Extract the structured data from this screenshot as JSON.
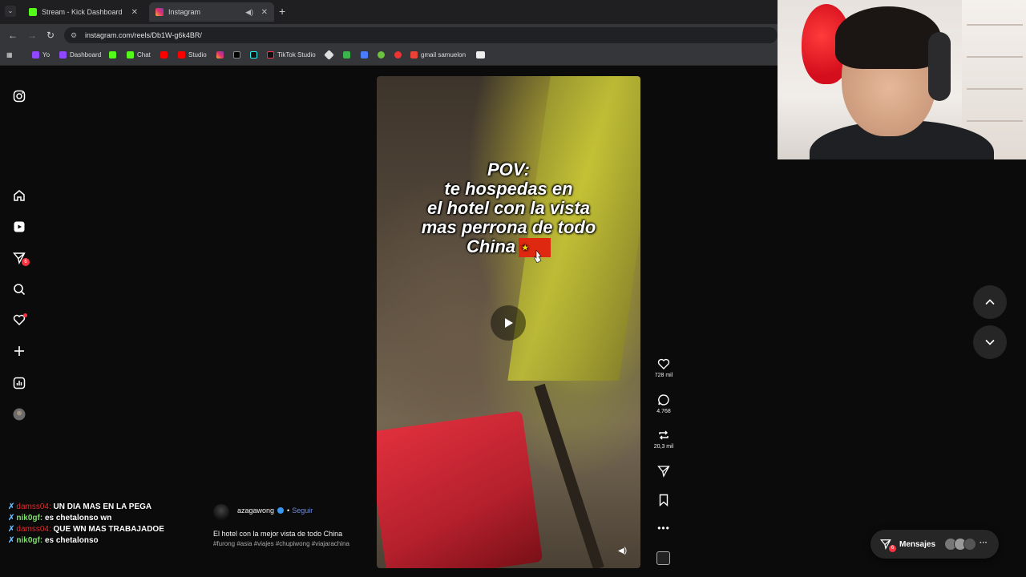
{
  "browser": {
    "tabs": [
      {
        "label": "Stream - Kick Dashboard",
        "active": false
      },
      {
        "label": "Instagram",
        "active": true
      }
    ],
    "url": "instagram.com/reels/Db1W-g6k4BR/",
    "bookmarks": [
      "Yo",
      "Dashboard",
      "Chat",
      "Studio",
      "TikTok Studio",
      "gmail samuelon"
    ]
  },
  "reel": {
    "caption_lines": [
      "POV:",
      "te hospedas en",
      "el hotel con la vista",
      "mas perrona de todo",
      "China"
    ],
    "author": "azagawong",
    "follow_label": "Seguir",
    "title": "El hotel con la mejor vista de todo China",
    "tags": "#furong #asia #viajes #chupiwong #viajarachina"
  },
  "actions": {
    "likes": "728 mil",
    "comments": "4.768",
    "reposts": "20,3 mil"
  },
  "sidebar": {
    "notifications_badge": "6"
  },
  "messages": {
    "label": "Mensajes",
    "badge": "6"
  },
  "chat": [
    {
      "user": "damss04:",
      "text": "UN DIA MAS EN LA PEGA",
      "user_color": "#e03030"
    },
    {
      "user": "nik0gf:",
      "text": "es chetalonso wn",
      "user_color": "#7ee06a"
    },
    {
      "user": "damss04:",
      "text": "QUE WN MAS TRABAJADOE",
      "user_color": "#e03030"
    },
    {
      "user": "nik0gf:",
      "text": "es chetalonso",
      "user_color": "#7ee06a"
    }
  ],
  "colors": {
    "accent_red": "#ff3040",
    "verified_blue": "#3897f0",
    "follow_blue": "#6f8fe0"
  }
}
